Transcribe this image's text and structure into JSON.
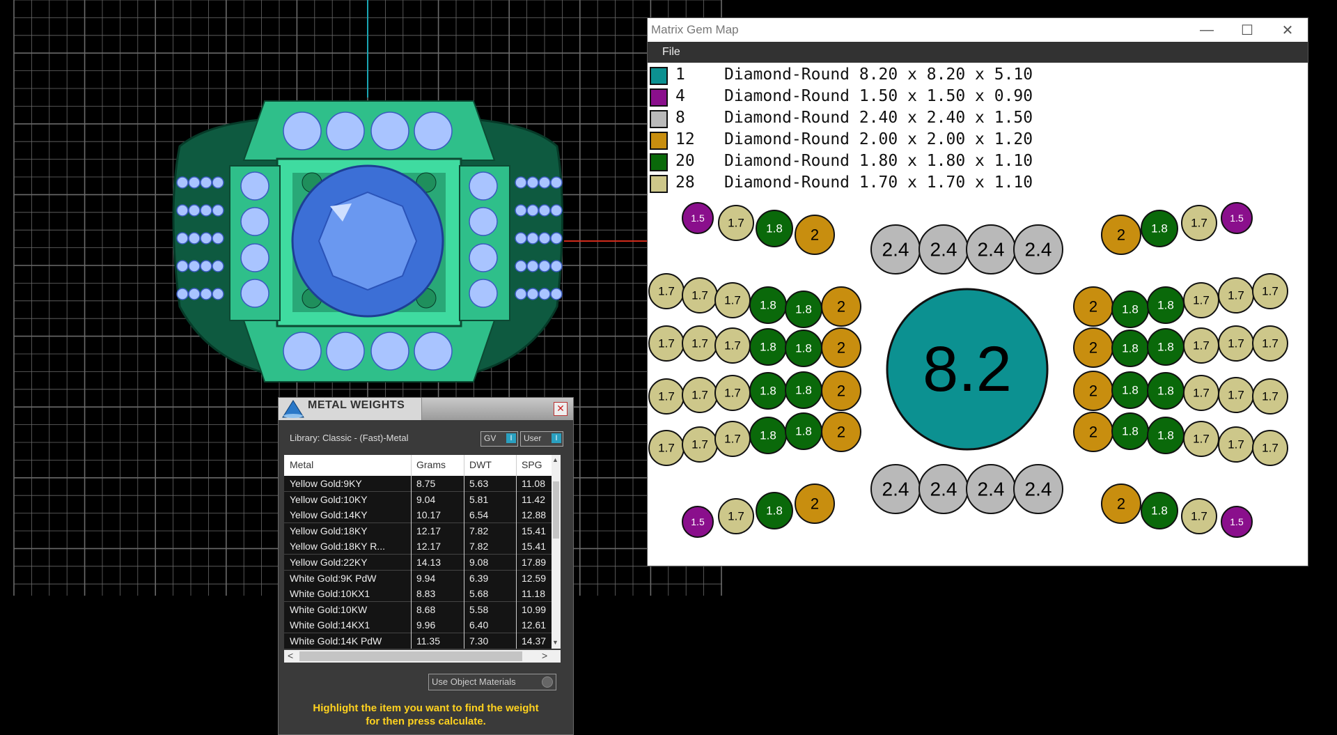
{
  "gem_map": {
    "title": "Matrix Gem Map",
    "controls": {
      "minimize": "—",
      "maximize": "☐",
      "close": "✕"
    },
    "menu": {
      "file": "File"
    },
    "legend": [
      {
        "count": "1",
        "description": "Diamond-Round 8.20 x 8.20 x 5.10",
        "color": "#0c9191"
      },
      {
        "count": "4",
        "description": "Diamond-Round 1.50 x 1.50 x 0.90",
        "color": "#8a0f8c"
      },
      {
        "count": "8",
        "description": "Diamond-Round 2.40 x 2.40 x 1.50",
        "color": "#b9b9b9"
      },
      {
        "count": "12",
        "description": "Diamond-Round 2.00 x 2.00 x 1.20",
        "color": "#c88e0f"
      },
      {
        "count": "20",
        "description": "Diamond-Round 1.80 x 1.80 x 1.10",
        "color": "#0a690a"
      },
      {
        "count": "28",
        "description": "Diamond-Round 1.70 x 1.70 x 1.10",
        "color": "#cdc78a"
      }
    ],
    "gem_colors": {
      "8.2": "#0c9191",
      "1.5": "#8a0f8c",
      "2.4": "#b9b9b9",
      "2": "#c88e0f",
      "1.8": "#0a690a",
      "1.7": "#cdc78a"
    },
    "gem_label_colors": {
      "1.5": "#ffffff",
      "1.8": "#ffffff",
      "8.2": "#000000",
      "2.4": "#000000",
      "2": "#000000",
      "1.7": "#000000"
    }
  },
  "metal_weights": {
    "title": "METAL WEIGHTS",
    "close": "✕",
    "library": "Library: Classic - (Fast)-Metal",
    "toggles": {
      "gv": "GV",
      "user": "User",
      "indicator": "I"
    },
    "columns": [
      "Metal",
      "Grams",
      "DWT",
      "SPG"
    ],
    "rows": [
      {
        "metal": "Yellow Gold:9KY",
        "grams": "8.75",
        "dwt": "5.63",
        "spg": "11.08"
      },
      {
        "metal": "Yellow Gold:10KY",
        "grams": "9.04",
        "dwt": "5.81",
        "spg": "11.42"
      },
      {
        "metal": "Yellow Gold:14KY",
        "grams": "10.17",
        "dwt": "6.54",
        "spg": "12.88"
      },
      {
        "metal": "Yellow Gold:18KY",
        "grams": "12.17",
        "dwt": "7.82",
        "spg": "15.41"
      },
      {
        "metal": "Yellow Gold:18KY R...",
        "grams": "12.17",
        "dwt": "7.82",
        "spg": "15.41"
      },
      {
        "metal": "Yellow Gold:22KY",
        "grams": "14.13",
        "dwt": "9.08",
        "spg": "17.89"
      },
      {
        "metal": "White Gold:9K PdW",
        "grams": "9.94",
        "dwt": "6.39",
        "spg": "12.59"
      },
      {
        "metal": "White Gold:10KX1",
        "grams": "8.83",
        "dwt": "5.68",
        "spg": "11.18"
      },
      {
        "metal": "White Gold:10KW",
        "grams": "8.68",
        "dwt": "5.58",
        "spg": "10.99"
      },
      {
        "metal": "White Gold:14KX1",
        "grams": "9.96",
        "dwt": "6.40",
        "spg": "12.61"
      },
      {
        "metal": "White Gold:14K PdW",
        "grams": "11.35",
        "dwt": "7.30",
        "spg": "14.37"
      }
    ],
    "scroll": {
      "up": "▲",
      "down": "▼",
      "left": "<",
      "right": ">"
    },
    "use_object_materials": "Use Object Materials",
    "hint_line1": "Highlight the item you want to find the weight",
    "hint_line2": "for then press calculate."
  },
  "viewport": {
    "colors": {
      "grid": "#6a6a6a",
      "metal": "#2fbf8a",
      "metal_dark": "#0e5a40",
      "center_stone": "#3c6fd6",
      "melee": "#a9c4ff",
      "axis_y": "#1aa6b4",
      "axis_x": "#d02a1a"
    }
  }
}
